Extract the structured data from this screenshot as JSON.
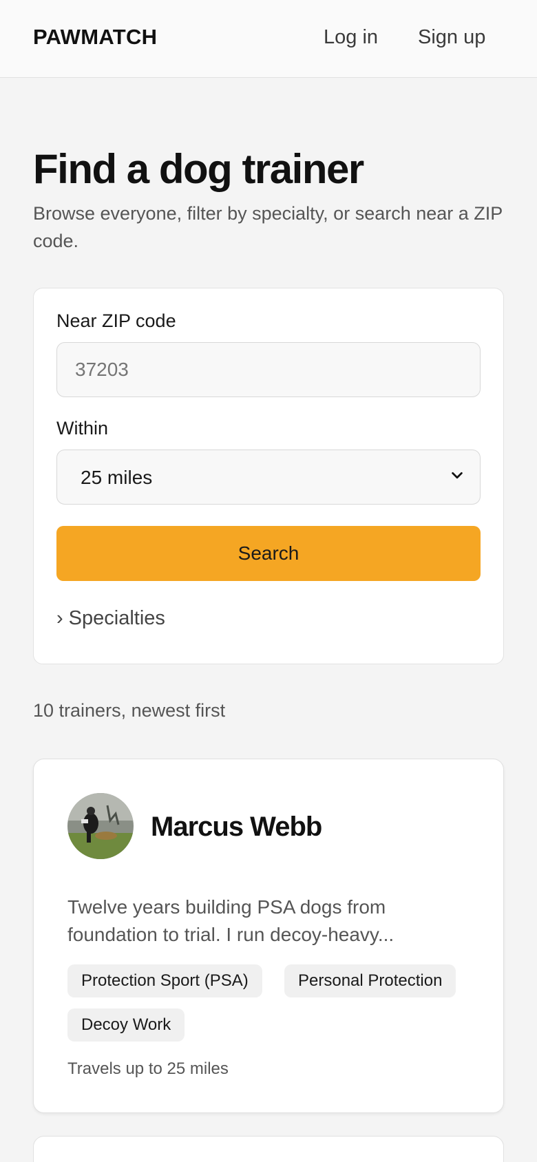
{
  "header": {
    "logo": "PAWMATCH",
    "login_label": "Log in",
    "signup_label": "Sign up"
  },
  "page": {
    "title": "Find a dog trainer",
    "subtitle": "Browse everyone, filter by specialty, or search near a ZIP code."
  },
  "search": {
    "zip_label": "Near ZIP code",
    "zip_placeholder": "37203",
    "within_label": "Within",
    "within_value": "25 miles",
    "button_label": "Search",
    "specialties_label": "Specialties",
    "specialties_caret": "›"
  },
  "results": {
    "summary": "10 trainers, newest first",
    "trainers": [
      {
        "name": "Marcus Webb",
        "bio": "Twelve years building PSA dogs from foundation to trial. I run decoy-heavy...",
        "tags": [
          "Protection Sport (PSA)",
          "Personal Protection",
          "Decoy Work"
        ],
        "travel": "Travels up to 25 miles"
      }
    ]
  },
  "colors": {
    "accent": "#f5a623",
    "background": "#f4f4f4"
  }
}
